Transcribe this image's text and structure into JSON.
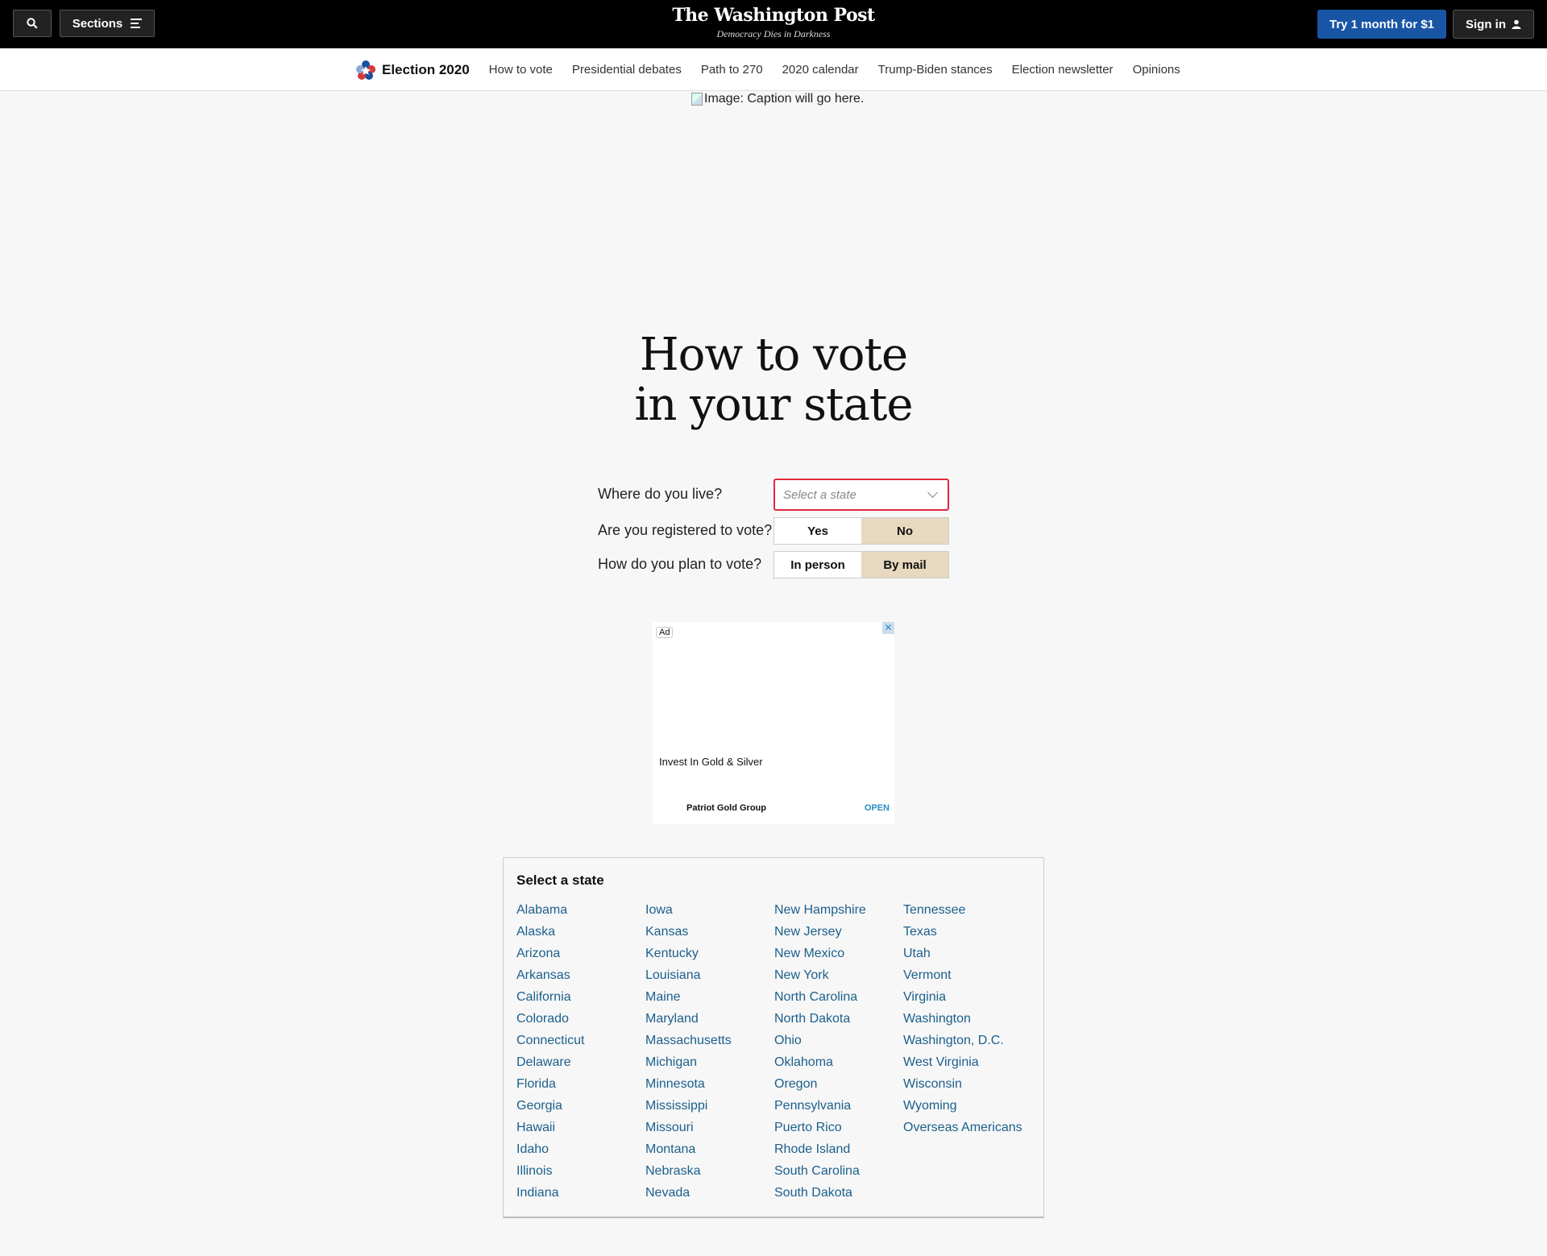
{
  "topbar": {
    "sections_label": "Sections",
    "logo_name": "The Washington Post",
    "logo_tagline": "Democracy Dies in Darkness",
    "try_label": "Try 1 month for $1",
    "signin_label": "Sign in"
  },
  "election_nav": {
    "brand": "Election 2020",
    "links": [
      "How to vote",
      "Presidential debates",
      "Path to 270",
      "2020 calendar",
      "Trump-Biden stances",
      "Election newsletter",
      "Opinions"
    ]
  },
  "caption": "Image: Caption will go here.",
  "headline": {
    "line1": "How to vote",
    "line2": "in your state"
  },
  "form": {
    "q_live": "Where do you live?",
    "state_placeholder": "Select a state",
    "q_registered": "Are you registered to vote?",
    "registered_yes": "Yes",
    "registered_no": "No",
    "q_plan": "How do you plan to vote?",
    "plan_in_person": "In person",
    "plan_by_mail": "By mail"
  },
  "ad": {
    "badge": "Ad",
    "headline": "Invest In Gold & Silver",
    "brand": "Patriot Gold Group",
    "cta": "OPEN"
  },
  "state_list": {
    "title": "Select a state",
    "columns": [
      [
        "Alabama",
        "Alaska",
        "Arizona",
        "Arkansas",
        "California",
        "Colorado",
        "Connecticut",
        "Delaware",
        "Florida",
        "Georgia",
        "Hawaii",
        "Idaho",
        "Illinois",
        "Indiana"
      ],
      [
        "Iowa",
        "Kansas",
        "Kentucky",
        "Louisiana",
        "Maine",
        "Maryland",
        "Massachusetts",
        "Michigan",
        "Minnesota",
        "Mississippi",
        "Missouri",
        "Montana",
        "Nebraska",
        "Nevada"
      ],
      [
        "New Hampshire",
        "New Jersey",
        "New Mexico",
        "New York",
        "North Carolina",
        "North Dakota",
        "Ohio",
        "Oklahoma",
        "Oregon",
        "Pennsylvania",
        "Puerto Rico",
        "Rhode Island",
        "South Carolina",
        "South Dakota"
      ],
      [
        "Tennessee",
        "Texas",
        "Utah",
        "Vermont",
        "Virginia",
        "Washington",
        "Washington, D.C.",
        "West Virginia",
        "Wisconsin",
        "Wyoming",
        "Overseas Americans"
      ]
    ]
  },
  "colors": {
    "accent_blue": "#1955a5",
    "link": "#1b5f8c",
    "selected_toggle": "#e8d8bf",
    "error_border": "#e0293c"
  }
}
